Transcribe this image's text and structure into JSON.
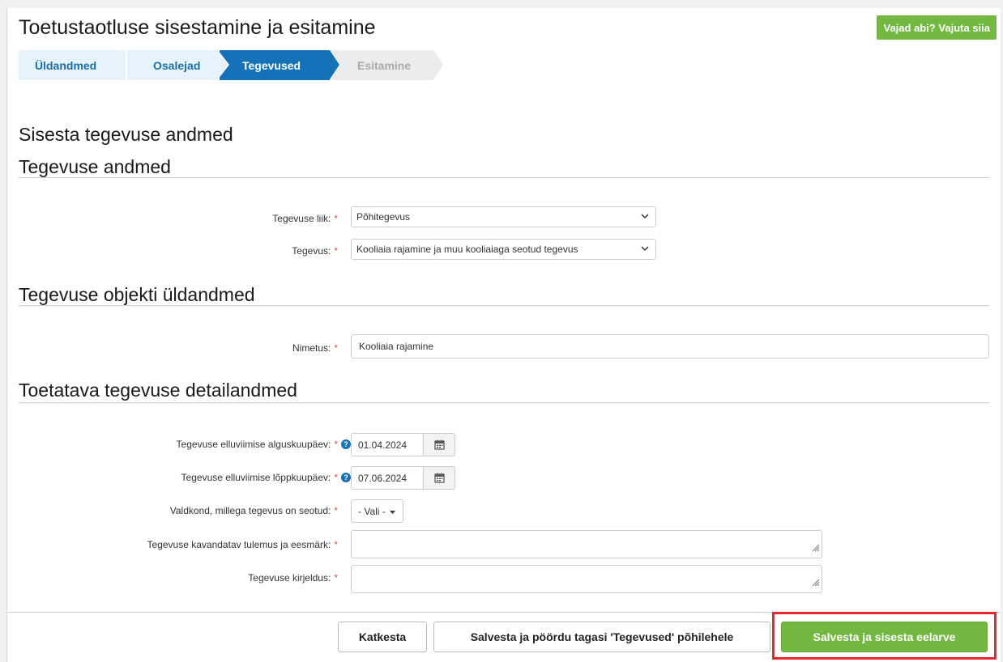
{
  "header": {
    "title": "Toetustaotluse sisestamine ja esitamine",
    "help_button": "Vajad abi? Vajuta siia"
  },
  "steps": [
    {
      "label": "Üldandmed",
      "state": "done"
    },
    {
      "label": "Osalejad",
      "state": "done"
    },
    {
      "label": "Tegevused",
      "state": "active"
    },
    {
      "label": "Esitamine",
      "state": "future"
    }
  ],
  "page": {
    "heading": "Sisesta tegevuse andmed"
  },
  "section_activity": {
    "heading": "Tegevuse andmed",
    "type_label": "Tegevuse liik:",
    "type_value": "Põhitegevus",
    "activity_label": "Tegevus:",
    "activity_value": "Kooliaia rajamine ja muu kooliaiaga seotud tegevus"
  },
  "section_object": {
    "heading": "Tegevuse objekti üldandmed",
    "name_label": "Nimetus:",
    "name_value": "Kooliaia rajamine"
  },
  "section_details": {
    "heading": "Toetatava tegevuse detailandmed",
    "start_label": "Tegevuse elluviimise alguskuupäev:",
    "start_value": "01.04.2024",
    "end_label": "Tegevuse elluviimise lõppkuupäev:",
    "end_value": "07.06.2024",
    "field_label": "Valdkond, millega tegevus on seotud:",
    "field_value": "- Vali -",
    "result_label": "Tegevuse kavandatav tulemus ja eesmärk:",
    "result_value": "",
    "desc_label": "Tegevuse kirjeldus:",
    "desc_value": ""
  },
  "required_marker": "*",
  "help_marker": "?",
  "footer": {
    "cancel": "Katkesta",
    "save_return": "Salvesta ja pöördu tagasi 'Tegevused' põhilehele",
    "save_budget": "Salvesta ja sisesta eelarve"
  },
  "colors": {
    "brand_blue": "#1572b8",
    "brand_green": "#72b841",
    "required_red": "#d9534f",
    "highlight_red": "#e8262b"
  },
  "icons": {
    "calendar": "calendar-icon",
    "help": "question-circle-icon",
    "chevron": "chevron-down-icon",
    "caret": "caret-down-icon",
    "resize": "resize-grip-icon"
  }
}
